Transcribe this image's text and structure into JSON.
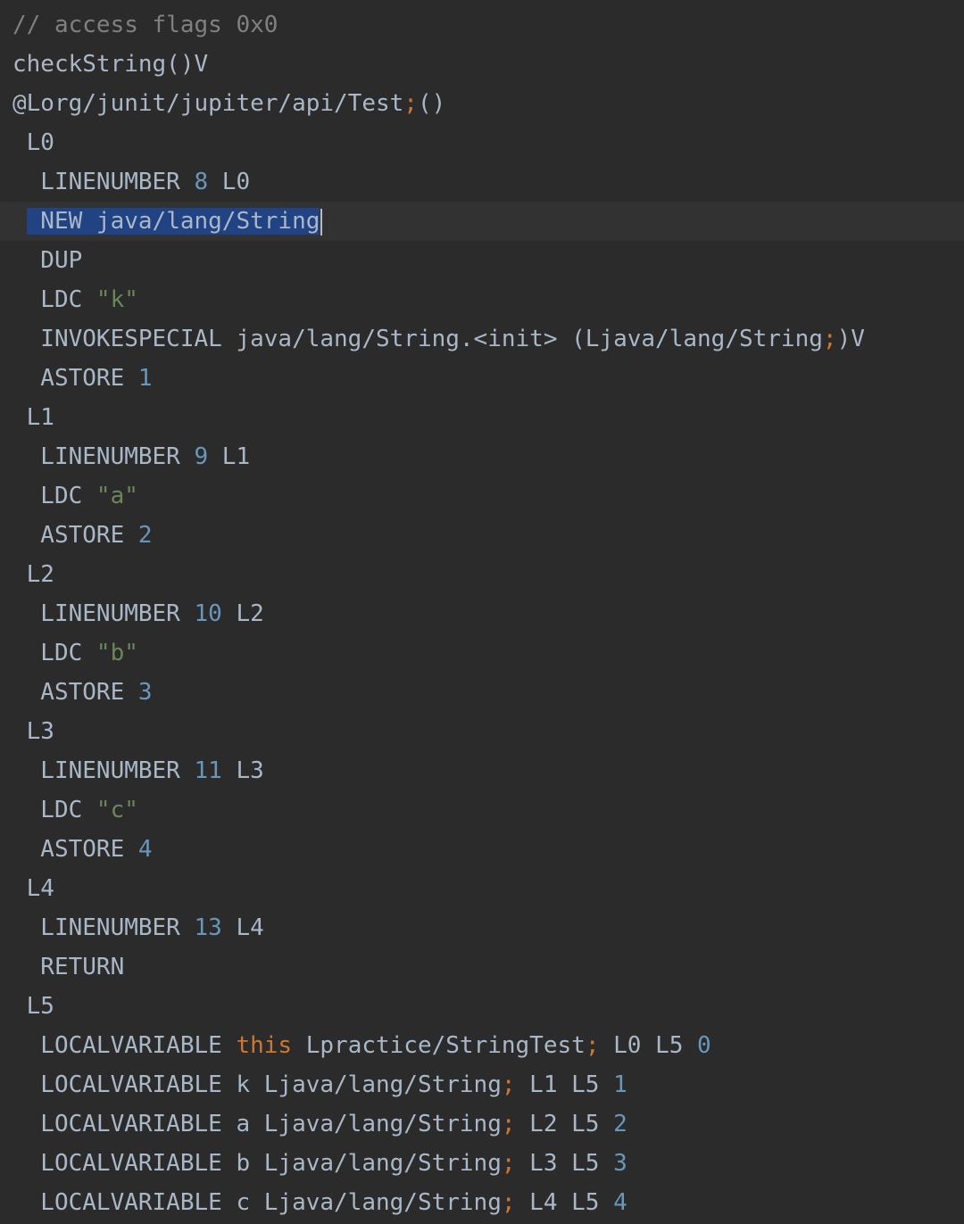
{
  "editor": {
    "lines": [
      {
        "tokens": [
          {
            "t": "// access flags 0x0",
            "k": "comment"
          }
        ]
      },
      {
        "tokens": [
          {
            "t": "checkString()V",
            "k": "plain"
          }
        ]
      },
      {
        "tokens": [
          {
            "t": "@Lorg/junit/jupiter/api/Test",
            "k": "plain"
          },
          {
            "t": ";",
            "k": "semi"
          },
          {
            "t": "()",
            "k": "plain"
          }
        ]
      },
      {
        "tokens": [
          {
            "t": " L0",
            "k": "plain"
          }
        ]
      },
      {
        "tokens": [
          {
            "t": "  LINENUMBER ",
            "k": "plain"
          },
          {
            "t": "8",
            "k": "number"
          },
          {
            "t": " L0",
            "k": "plain"
          }
        ]
      },
      {
        "current": true,
        "tokens": [
          {
            "t": " ",
            "k": "plain"
          },
          {
            "t": " NEW java/lang/String",
            "k": "plain",
            "selected": true
          }
        ],
        "caret": true
      },
      {
        "tokens": [
          {
            "t": "  DUP",
            "k": "plain"
          }
        ]
      },
      {
        "tokens": [
          {
            "t": "  LDC ",
            "k": "plain"
          },
          {
            "t": "\"k\"",
            "k": "string"
          }
        ]
      },
      {
        "tokens": [
          {
            "t": "  INVOKESPECIAL java/lang/String.<init> (Ljava/lang/String",
            "k": "plain"
          },
          {
            "t": ";",
            "k": "semi"
          },
          {
            "t": ")V",
            "k": "plain"
          }
        ]
      },
      {
        "tokens": [
          {
            "t": "  ASTORE ",
            "k": "plain"
          },
          {
            "t": "1",
            "k": "number"
          }
        ]
      },
      {
        "tokens": [
          {
            "t": " L1",
            "k": "plain"
          }
        ]
      },
      {
        "tokens": [
          {
            "t": "  LINENUMBER ",
            "k": "plain"
          },
          {
            "t": "9",
            "k": "number"
          },
          {
            "t": " L1",
            "k": "plain"
          }
        ]
      },
      {
        "tokens": [
          {
            "t": "  LDC ",
            "k": "plain"
          },
          {
            "t": "\"a\"",
            "k": "string"
          }
        ]
      },
      {
        "tokens": [
          {
            "t": "  ASTORE ",
            "k": "plain"
          },
          {
            "t": "2",
            "k": "number"
          }
        ]
      },
      {
        "tokens": [
          {
            "t": " L2",
            "k": "plain"
          }
        ]
      },
      {
        "tokens": [
          {
            "t": "  LINENUMBER ",
            "k": "plain"
          },
          {
            "t": "10",
            "k": "number"
          },
          {
            "t": " L2",
            "k": "plain"
          }
        ]
      },
      {
        "tokens": [
          {
            "t": "  LDC ",
            "k": "plain"
          },
          {
            "t": "\"b\"",
            "k": "string"
          }
        ]
      },
      {
        "tokens": [
          {
            "t": "  ASTORE ",
            "k": "plain"
          },
          {
            "t": "3",
            "k": "number"
          }
        ]
      },
      {
        "tokens": [
          {
            "t": " L3",
            "k": "plain"
          }
        ]
      },
      {
        "tokens": [
          {
            "t": "  LINENUMBER ",
            "k": "plain"
          },
          {
            "t": "11",
            "k": "number"
          },
          {
            "t": " L3",
            "k": "plain"
          }
        ]
      },
      {
        "tokens": [
          {
            "t": "  LDC ",
            "k": "plain"
          },
          {
            "t": "\"c\"",
            "k": "string"
          }
        ]
      },
      {
        "tokens": [
          {
            "t": "  ASTORE ",
            "k": "plain"
          },
          {
            "t": "4",
            "k": "number"
          }
        ]
      },
      {
        "tokens": [
          {
            "t": " L4",
            "k": "plain"
          }
        ]
      },
      {
        "tokens": [
          {
            "t": "  LINENUMBER ",
            "k": "plain"
          },
          {
            "t": "13",
            "k": "number"
          },
          {
            "t": " L4",
            "k": "plain"
          }
        ]
      },
      {
        "tokens": [
          {
            "t": "  RETURN",
            "k": "plain"
          }
        ]
      },
      {
        "tokens": [
          {
            "t": " L5",
            "k": "plain"
          }
        ]
      },
      {
        "tokens": [
          {
            "t": "  LOCALVARIABLE ",
            "k": "plain"
          },
          {
            "t": "this",
            "k": "keyword"
          },
          {
            "t": " Lpractice/StringTest",
            "k": "plain"
          },
          {
            "t": ";",
            "k": "semi"
          },
          {
            "t": " L0 L5 ",
            "k": "plain"
          },
          {
            "t": "0",
            "k": "number"
          }
        ]
      },
      {
        "tokens": [
          {
            "t": "  LOCALVARIABLE k Ljava/lang/String",
            "k": "plain"
          },
          {
            "t": ";",
            "k": "semi"
          },
          {
            "t": " L1 L5 ",
            "k": "plain"
          },
          {
            "t": "1",
            "k": "number"
          }
        ]
      },
      {
        "tokens": [
          {
            "t": "  LOCALVARIABLE a Ljava/lang/String",
            "k": "plain"
          },
          {
            "t": ";",
            "k": "semi"
          },
          {
            "t": " L2 L5 ",
            "k": "plain"
          },
          {
            "t": "2",
            "k": "number"
          }
        ]
      },
      {
        "tokens": [
          {
            "t": "  LOCALVARIABLE b Ljava/lang/String",
            "k": "plain"
          },
          {
            "t": ";",
            "k": "semi"
          },
          {
            "t": " L3 L5 ",
            "k": "plain"
          },
          {
            "t": "3",
            "k": "number"
          }
        ]
      },
      {
        "tokens": [
          {
            "t": "  LOCALVARIABLE c Ljava/lang/String",
            "k": "plain"
          },
          {
            "t": ";",
            "k": "semi"
          },
          {
            "t": " L4 L5 ",
            "k": "plain"
          },
          {
            "t": "4",
            "k": "number"
          }
        ]
      }
    ]
  },
  "colors": {
    "background": "#2b2b2b",
    "current_line": "#323232",
    "selection": "#214283",
    "text": "#a9b7c6",
    "comment": "#808080",
    "number": "#6897bb",
    "string": "#6a8759",
    "keyword": "#cc7832"
  }
}
